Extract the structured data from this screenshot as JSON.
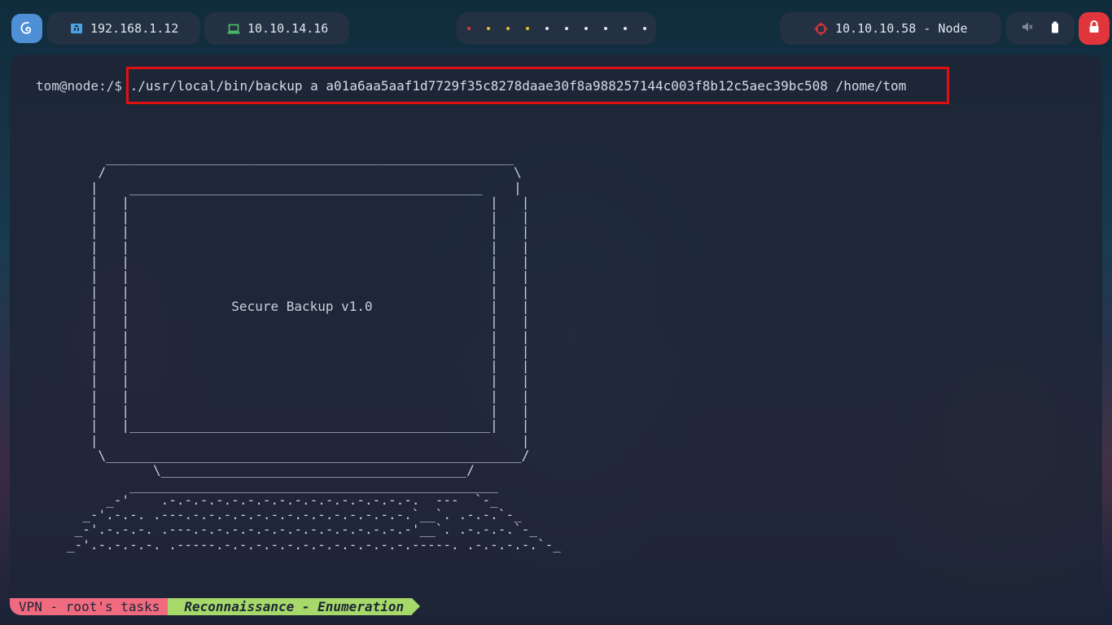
{
  "topbar": {
    "local_ip": "192.168.1.12",
    "vpn_ip": "10.10.14.16",
    "target": "10.10.10.58 - Node",
    "workspace_dot_colors": [
      "#e0353b",
      "#e8b931",
      "#e8b931",
      "#e8b931",
      "#dfe6ee",
      "#dfe6ee",
      "#dfe6ee",
      "#dfe6ee",
      "#dfe6ee",
      "#dfe6ee"
    ],
    "icons": {
      "logo": "debian-swirl-icon",
      "local": "ethernet-icon",
      "vpn": "laptop-icon",
      "target": "crosshair-icon",
      "mute": "speaker-muted-icon",
      "battery": "battery-icon",
      "lock": "lock-icon"
    },
    "colors": {
      "logo_bg": "#4e8fd6",
      "local_icon": "#4aa3e8",
      "vpn_icon": "#4cc46a",
      "target_icon": "#e0353b",
      "lock_bg": "#e0353b"
    }
  },
  "terminal": {
    "prompt": "tom@node:/$",
    "command": " ./usr/local/bin/backup a a01a6aa5aaf1d7729f35c8278daae30f8a988257144c003f8b12c5aec39bc508 /home/tom",
    "banner_title": "Secure Backup v1.0"
  },
  "statusline": {
    "session": "VPN - root's tasks",
    "phase": "Reconnaissance - Enumeration"
  }
}
